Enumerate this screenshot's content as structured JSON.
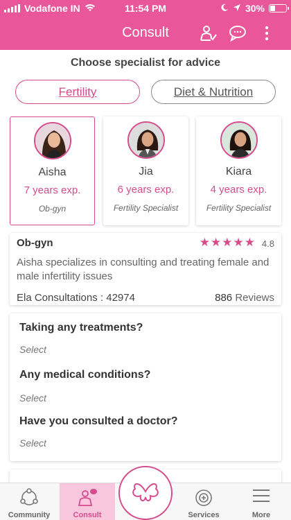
{
  "status_bar": {
    "carrier": "Vodafone IN",
    "time": "11:54 PM",
    "battery": "30%",
    "battery_level": 0.3
  },
  "header": {
    "title": "Consult"
  },
  "main": {
    "choose_title": "Choose specialist for advice",
    "categories": [
      "Fertility",
      "Diet & Nutrition"
    ],
    "specialists": [
      {
        "name": "Aisha",
        "experience": "7 years exp.",
        "title": "Ob-gyn"
      },
      {
        "name": "Jia",
        "experience": "6 years exp.",
        "title": "Fertility Specialist"
      },
      {
        "name": "Kiara",
        "experience": "4 years exp.",
        "title": "Fertility Specialist"
      }
    ],
    "detail": {
      "specialty": "Ob-gyn",
      "rating": "4.8",
      "rating_stars": 5,
      "description": "Aisha specializes in consulting and treating female and male infertility issues",
      "consultations_label": "Ela Consultations :",
      "consultations_count": "42974",
      "reviews_count": "886",
      "reviews_label": "Reviews"
    },
    "questions": [
      {
        "question": "Taking any treatments?",
        "placeholder": "Select"
      },
      {
        "question": "Any medical conditions?",
        "placeholder": "Select"
      },
      {
        "question": "Have you consulted a doctor?",
        "placeholder": "Select"
      }
    ]
  },
  "bottom_nav": {
    "items": [
      {
        "label": "Community",
        "icon": "community-icon"
      },
      {
        "label": "Consult",
        "icon": "consult-icon"
      },
      {
        "label": "Services",
        "icon": "services-icon"
      },
      {
        "label": "More",
        "icon": "menu-icon"
      }
    ],
    "center_icon": "ela-logo-icon"
  },
  "colors": {
    "accent": "#e9569a",
    "accent_dark": "#d54c8c",
    "active_tab_bg": "#f8c6dd"
  }
}
